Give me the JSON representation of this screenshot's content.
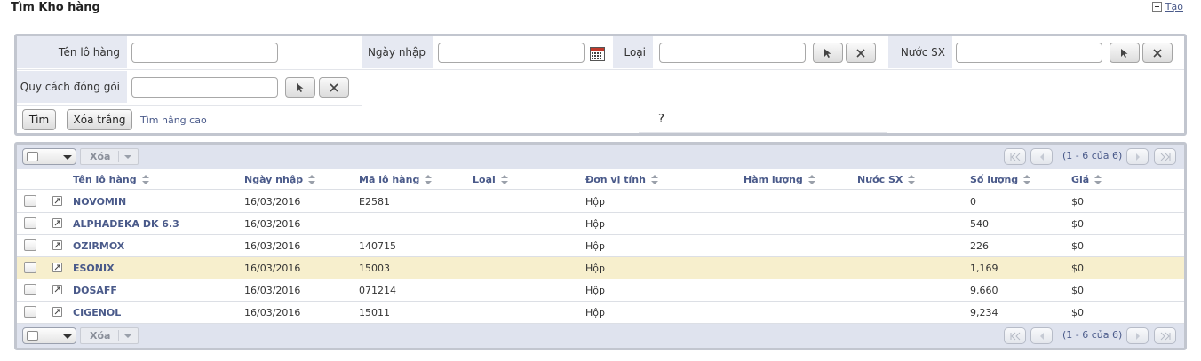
{
  "page": {
    "title": "Tìm Kho hàng",
    "create_label": "Tạo"
  },
  "search": {
    "fields": {
      "ten_lo_hang": {
        "label": "Tên lô hàng",
        "value": "",
        "placeholder": ""
      },
      "ngay_nhap": {
        "label": "Ngày nhập",
        "value": "",
        "placeholder": ""
      },
      "loai": {
        "label": "Loại",
        "value": "",
        "placeholder": ""
      },
      "nuoc_sx": {
        "label": "Nước SX",
        "value": "",
        "placeholder": ""
      },
      "quy_cach": {
        "label": "Quy cách đóng gói",
        "value": "",
        "placeholder": ""
      }
    },
    "buttons": {
      "search": "Tìm",
      "clear": "Xóa trắng",
      "advanced": "Tìm nâng cao"
    },
    "help_text": "?"
  },
  "grid": {
    "toolbar": {
      "delete_label": "Xóa",
      "pager_info": "(1 - 6 của 6)"
    },
    "columns": [
      "Tên lô hàng",
      "Ngày nhập",
      "Mã lô hàng",
      "Loại",
      "Đơn vị tính",
      "Hàm lượng",
      "Nước SX",
      "Số lượng",
      "Giá"
    ],
    "rows": [
      {
        "ten": "NOVOMIN",
        "ngay": "16/03/2016",
        "ma": "E2581",
        "loai": "",
        "dvt": "Hộp",
        "ham_luong": "",
        "nuoc": "",
        "so_luong": "0",
        "gia": "$0",
        "highlighted": false
      },
      {
        "ten": "ALPHADEKA DK 6.3",
        "ngay": "16/03/2016",
        "ma": "",
        "loai": "",
        "dvt": "Hộp",
        "ham_luong": "",
        "nuoc": "",
        "so_luong": "540",
        "gia": "$0",
        "highlighted": false
      },
      {
        "ten": "OZIRMOX",
        "ngay": "16/03/2016",
        "ma": "140715",
        "loai": "",
        "dvt": "Hộp",
        "ham_luong": "",
        "nuoc": "",
        "so_luong": "226",
        "gia": "$0",
        "highlighted": false
      },
      {
        "ten": "ESONIX",
        "ngay": "16/03/2016",
        "ma": "15003",
        "loai": "",
        "dvt": "Hộp",
        "ham_luong": "",
        "nuoc": "",
        "so_luong": "1,169",
        "gia": "$0",
        "highlighted": true
      },
      {
        "ten": "DOSAFF",
        "ngay": "16/03/2016",
        "ma": "071214",
        "loai": "",
        "dvt": "Hộp",
        "ham_luong": "",
        "nuoc": "",
        "so_luong": "9,660",
        "gia": "$0",
        "highlighted": false
      },
      {
        "ten": "CIGENOL",
        "ngay": "16/03/2016",
        "ma": "15011",
        "loai": "",
        "dvt": "Hộp",
        "ham_luong": "",
        "nuoc": "",
        "so_luong": "9,234",
        "gia": "$0",
        "highlighted": false
      }
    ]
  },
  "icons": {
    "pick": "cursor-icon",
    "clear": "close-icon",
    "calendar": "calendar-icon",
    "edit": "edit-icon",
    "create": "plus-icon"
  }
}
